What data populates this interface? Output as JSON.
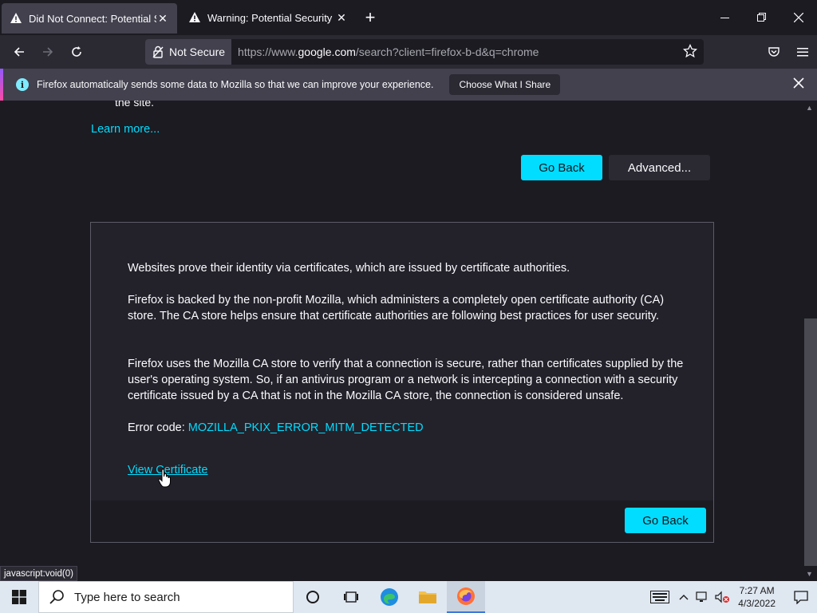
{
  "tabs": [
    {
      "title": "Did Not Connect: Potential Secu",
      "active": true
    },
    {
      "title": "Warning: Potential Security Risk",
      "active": false
    }
  ],
  "nav": {
    "not_secure_label": "Not Secure",
    "url_prefix": "https://www.",
    "url_host": "google.com",
    "url_rest": "/search?client=firefox-b-d&q=chrome"
  },
  "infobar": {
    "message": "Firefox automatically sends some data to Mozilla so that we can improve your experience.",
    "button": "Choose What I Share"
  },
  "page": {
    "partial_text": "the site.",
    "learn_more": "Learn more...",
    "go_back": "Go Back",
    "advanced": "Advanced...",
    "panel": {
      "p1": "Websites prove their identity via certificates, which are issued by certificate authorities.",
      "p2": "Firefox is backed by the non-profit Mozilla, which administers a completely open certificate authority (CA) store. The CA store helps ensure that certificate authorities are following best practices for user security.",
      "p3": "Firefox uses the Mozilla CA store to verify that a connection is secure, rather than certificates supplied by the user's operating system. So, if an antivirus program or a network is intercepting a connection with a security certificate issued by a CA that is not in the Mozilla CA store, the connection is considered unsafe.",
      "error_label": "Error code: ",
      "error_code": "MOZILLA_PKIX_ERROR_MITM_DETECTED",
      "view_certificate": "View Certificate",
      "go_back": "Go Back"
    }
  },
  "status_link": "javascript:void(0)",
  "taskbar": {
    "search_placeholder": "Type here to search",
    "time": "7:27 AM",
    "date": "4/3/2022"
  },
  "colors": {
    "accent": "#00ddff",
    "background": "#1c1b22",
    "toolbar": "#2b2a33",
    "taskbar": "#dfe7f1"
  }
}
